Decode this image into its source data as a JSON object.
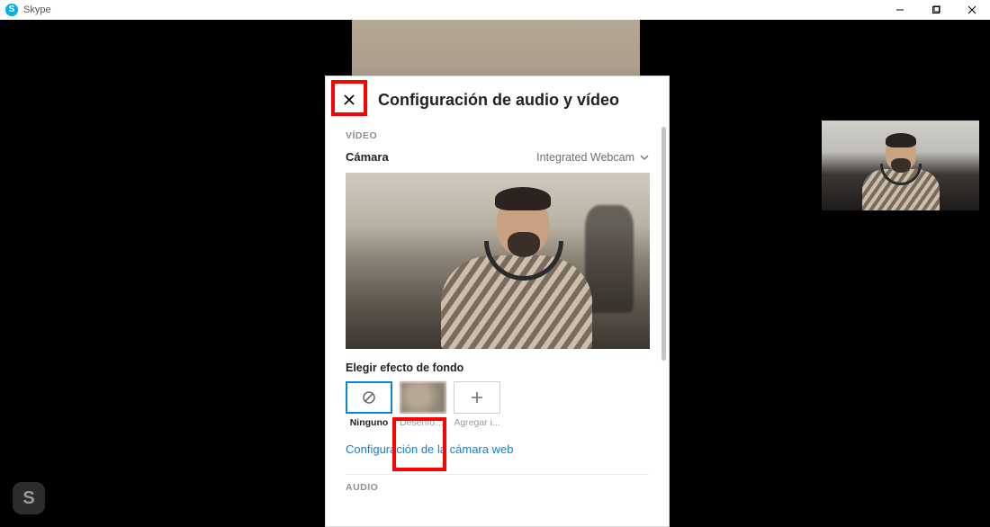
{
  "window": {
    "app_title": "Skype",
    "skype_glyph": "S"
  },
  "dock": {
    "glyph": "S"
  },
  "dialog": {
    "title": "Configuración de audio y vídeo",
    "video_section": "VÍDEO",
    "camera_label": "Cámara",
    "camera_device": "Integrated Webcam",
    "background_heading": "Elegir efecto de fondo",
    "effects": {
      "none": "Ninguno",
      "blur": "Desenfoq...",
      "add": "Agregar i..."
    },
    "webcam_settings_link": "Configuración de la cámara web",
    "audio_section": "AUDIO"
  }
}
